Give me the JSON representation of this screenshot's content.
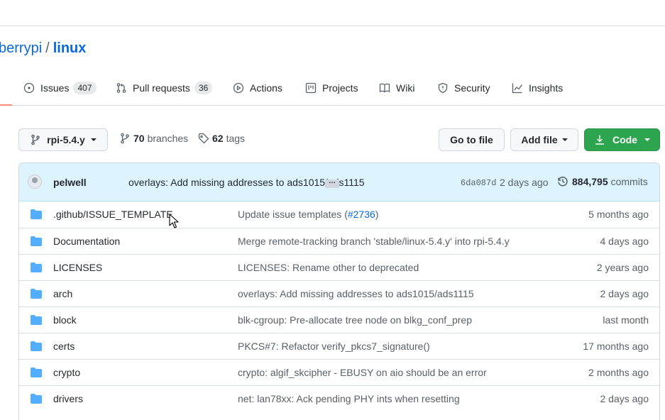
{
  "repo": {
    "owner": "berrypi",
    "separator": "/",
    "name": "linux"
  },
  "tabs": [
    {
      "label": "Issues",
      "count": "407",
      "icon": "issue-icon"
    },
    {
      "label": "Pull requests",
      "count": "36",
      "icon": "pull-request-icon"
    },
    {
      "label": "Actions",
      "icon": "play-icon"
    },
    {
      "label": "Projects",
      "icon": "project-icon"
    },
    {
      "label": "Wiki",
      "icon": "book-icon"
    },
    {
      "label": "Security",
      "icon": "shield-icon"
    },
    {
      "label": "Insights",
      "icon": "graph-icon"
    }
  ],
  "toolbar": {
    "branch": "rpi-5.4.y",
    "branches_count": "70",
    "branches_label": "branches",
    "tags_count": "62",
    "tags_label": "tags",
    "go_to_file": "Go to file",
    "add_file": "Add file",
    "code": "Code"
  },
  "latest_commit": {
    "author": "pelwell",
    "message": "overlays: Add missing addresses to ads1015/ads1115",
    "ellipsis": "…",
    "sha": "6da087d",
    "age": "2 days ago",
    "commit_count": "884,795",
    "commits_label": "commits"
  },
  "files": [
    {
      "name": ".github/ISSUE_TEMPLATE",
      "message": "Update issue templates (",
      "link": "#2736",
      "message_end": ")",
      "age": "5 months ago"
    },
    {
      "name": "Documentation",
      "message": "Merge remote-tracking branch 'stable/linux-5.4.y' into rpi-5.4.y",
      "age": "4 days ago"
    },
    {
      "name": "LICENSES",
      "message": "LICENSES: Rename other to deprecated",
      "age": "2 years ago"
    },
    {
      "name": "arch",
      "message": "overlays: Add missing addresses to ads1015/ads1115",
      "age": "2 days ago"
    },
    {
      "name": "block",
      "message": "blk-cgroup: Pre-allocate tree node on blkg_conf_prep",
      "age": "last month"
    },
    {
      "name": "certs",
      "message": "PKCS#7: Refactor verify_pkcs7_signature()",
      "age": "17 months ago"
    },
    {
      "name": "crypto",
      "message": "crypto: algif_skcipher - EBUSY on aio should be an error",
      "age": "2 months ago"
    },
    {
      "name": "drivers",
      "message": "net: lan78xx: Ack pending PHY ints when resetting",
      "age": "2 days ago"
    }
  ],
  "colors": {
    "link": "#0969da",
    "green_button": "#2da44e",
    "commit_bar": "#ddf4ff",
    "folder": "#54aeff",
    "active_tab_underline": "#fd8c73"
  }
}
